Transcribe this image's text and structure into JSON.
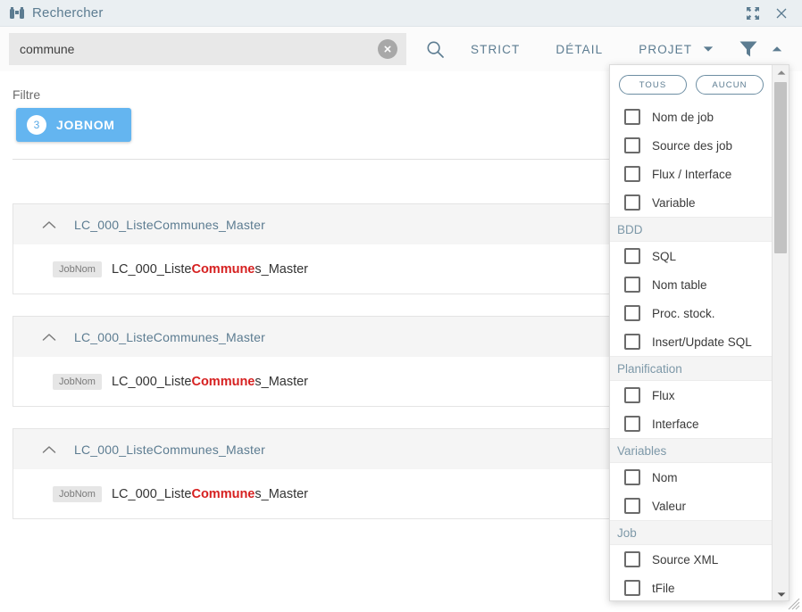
{
  "window": {
    "title": "Rechercher",
    "icon": "binoculars-icon",
    "maximize_icon": "maximize-icon",
    "close_icon": "close-icon"
  },
  "search": {
    "value": "commune",
    "placeholder": "",
    "clear_icon": "clear-circle-icon",
    "search_icon": "search-icon"
  },
  "toolbar": {
    "strict_label": "STRICT",
    "detail_label": "DÉTAIL",
    "projet_label": "PROJET",
    "projet_caret_icon": "chevron-down-icon",
    "funnel_icon": "funnel-icon",
    "collapse_icon": "chevron-up-icon"
  },
  "filter": {
    "label": "Filtre",
    "chips": [
      {
        "count": "3",
        "label": "JOBNOM"
      }
    ]
  },
  "results": [
    {
      "title": "LC_000_ListeCommunes_Master",
      "collapse_icon": "chevron-up-icon",
      "tag": "JobNom",
      "text_before": "LC_000_Liste",
      "text_match": "Commune",
      "text_after": "s_Master"
    },
    {
      "title": "LC_000_ListeCommunes_Master",
      "collapse_icon": "chevron-up-icon",
      "tag": "JobNom",
      "text_before": "LC_000_Liste",
      "text_match": "Commune",
      "text_after": "s_Master"
    },
    {
      "title": "LC_000_ListeCommunes_Master",
      "collapse_icon": "chevron-up-icon",
      "tag": "JobNom",
      "text_before": "LC_000_Liste",
      "text_match": "Commune",
      "text_after": "s_Master"
    }
  ],
  "dropdown": {
    "select_all_label": "TOUS",
    "select_none_label": "AUCUN",
    "scroll_up_icon": "scroll-up-arrow-icon",
    "scroll_down_icon": "scroll-down-arrow-icon",
    "groups": [
      {
        "header": null,
        "items": [
          {
            "label": "Nom de job",
            "checked": false
          },
          {
            "label": "Source des job",
            "checked": false
          },
          {
            "label": "Flux / Interface",
            "checked": false
          },
          {
            "label": "Variable",
            "checked": false
          }
        ]
      },
      {
        "header": "BDD",
        "items": [
          {
            "label": "SQL",
            "checked": false
          },
          {
            "label": "Nom table",
            "checked": false
          },
          {
            "label": "Proc. stock.",
            "checked": false
          },
          {
            "label": "Insert/Update SQL",
            "checked": false
          }
        ]
      },
      {
        "header": "Planification",
        "items": [
          {
            "label": "Flux",
            "checked": false
          },
          {
            "label": "Interface",
            "checked": false
          }
        ]
      },
      {
        "header": "Variables",
        "items": [
          {
            "label": "Nom",
            "checked": false
          },
          {
            "label": "Valeur",
            "checked": false
          }
        ]
      },
      {
        "header": "Job",
        "items": [
          {
            "label": "Source XML",
            "checked": false
          },
          {
            "label": "tFile",
            "checked": false
          }
        ]
      }
    ]
  },
  "colors": {
    "titlebar_bg": "#eaeff2",
    "accent_slate": "#5c7c91",
    "chip_blue": "#64b5f0",
    "highlight_red": "#d62020",
    "search_field_bg": "#e8e8e8"
  }
}
